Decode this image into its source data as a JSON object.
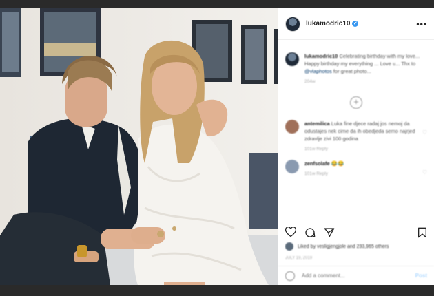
{
  "post": {
    "username": "lukamodric10",
    "more_label": "•••",
    "caption": {
      "username": "lukamodric10",
      "text": "Celebrating birthday with my love... Happy birthday my everything ... Love u... Thx to",
      "mention": "@vlaphotos",
      "tail": "for great photo...",
      "meta": "204w"
    },
    "load_more": "+",
    "comments": [
      {
        "username": "antemilica",
        "text": "Luka fine djece radaj jos nemoj da odustajes nek cime da ih obedjeda semo najrjed zdravlje zivi 100 godina",
        "meta": "101w  Reply",
        "avatar_color": "#a0705a"
      },
      {
        "username": "zenfsolafe",
        "text": "",
        "meta": "101w  Reply",
        "avatar_color": "#8a9ab0"
      }
    ],
    "likes_text": "Liked by vesligjengjole and 233,965 others",
    "date": "JULY 19, 2019",
    "add_comment_placeholder": "Add a comment...",
    "post_button": "Post"
  },
  "colors": {
    "verified": "#3897f0",
    "link": "#00376b",
    "post_disabled": "#b3dbff"
  },
  "icons": [
    "heart-icon",
    "comment-icon",
    "share-icon",
    "bookmark-icon",
    "emoji-icon",
    "verified-badge-icon"
  ]
}
